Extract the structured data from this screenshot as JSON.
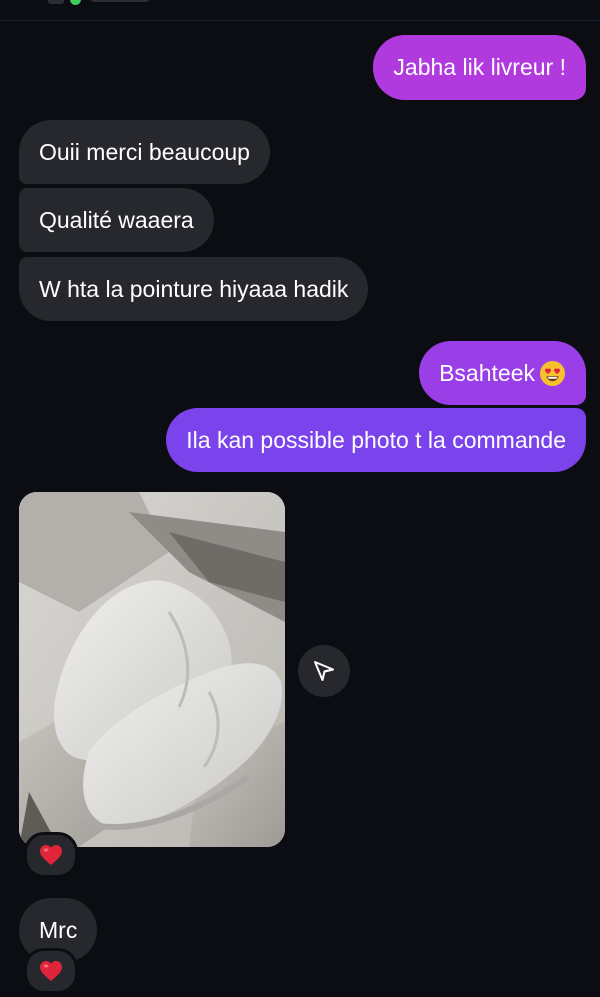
{
  "messages": {
    "out_1": "Jabha lik livreur !",
    "in_1": "Ouii merci beaucoup",
    "in_2": "Qualité waaera",
    "in_3": "W hta la pointure hiyaaa hadik",
    "out_2": "Bsahteek",
    "out_3": "Ila kan possible photo t la commande",
    "in_4": "Mrc"
  },
  "reactions": {
    "photo": "heart",
    "mrc": "heart"
  },
  "icons": {
    "share": "send-icon",
    "emoji": "heart-eyes-emoji"
  },
  "colors": {
    "background": "#0b0d12",
    "incoming_bubble": "#26282d",
    "outgoing_top": "#b13adf",
    "outgoing_mid": "#9a3ee8",
    "outgoing_bottom": "#7b43ec",
    "heart": "#e0243a"
  }
}
